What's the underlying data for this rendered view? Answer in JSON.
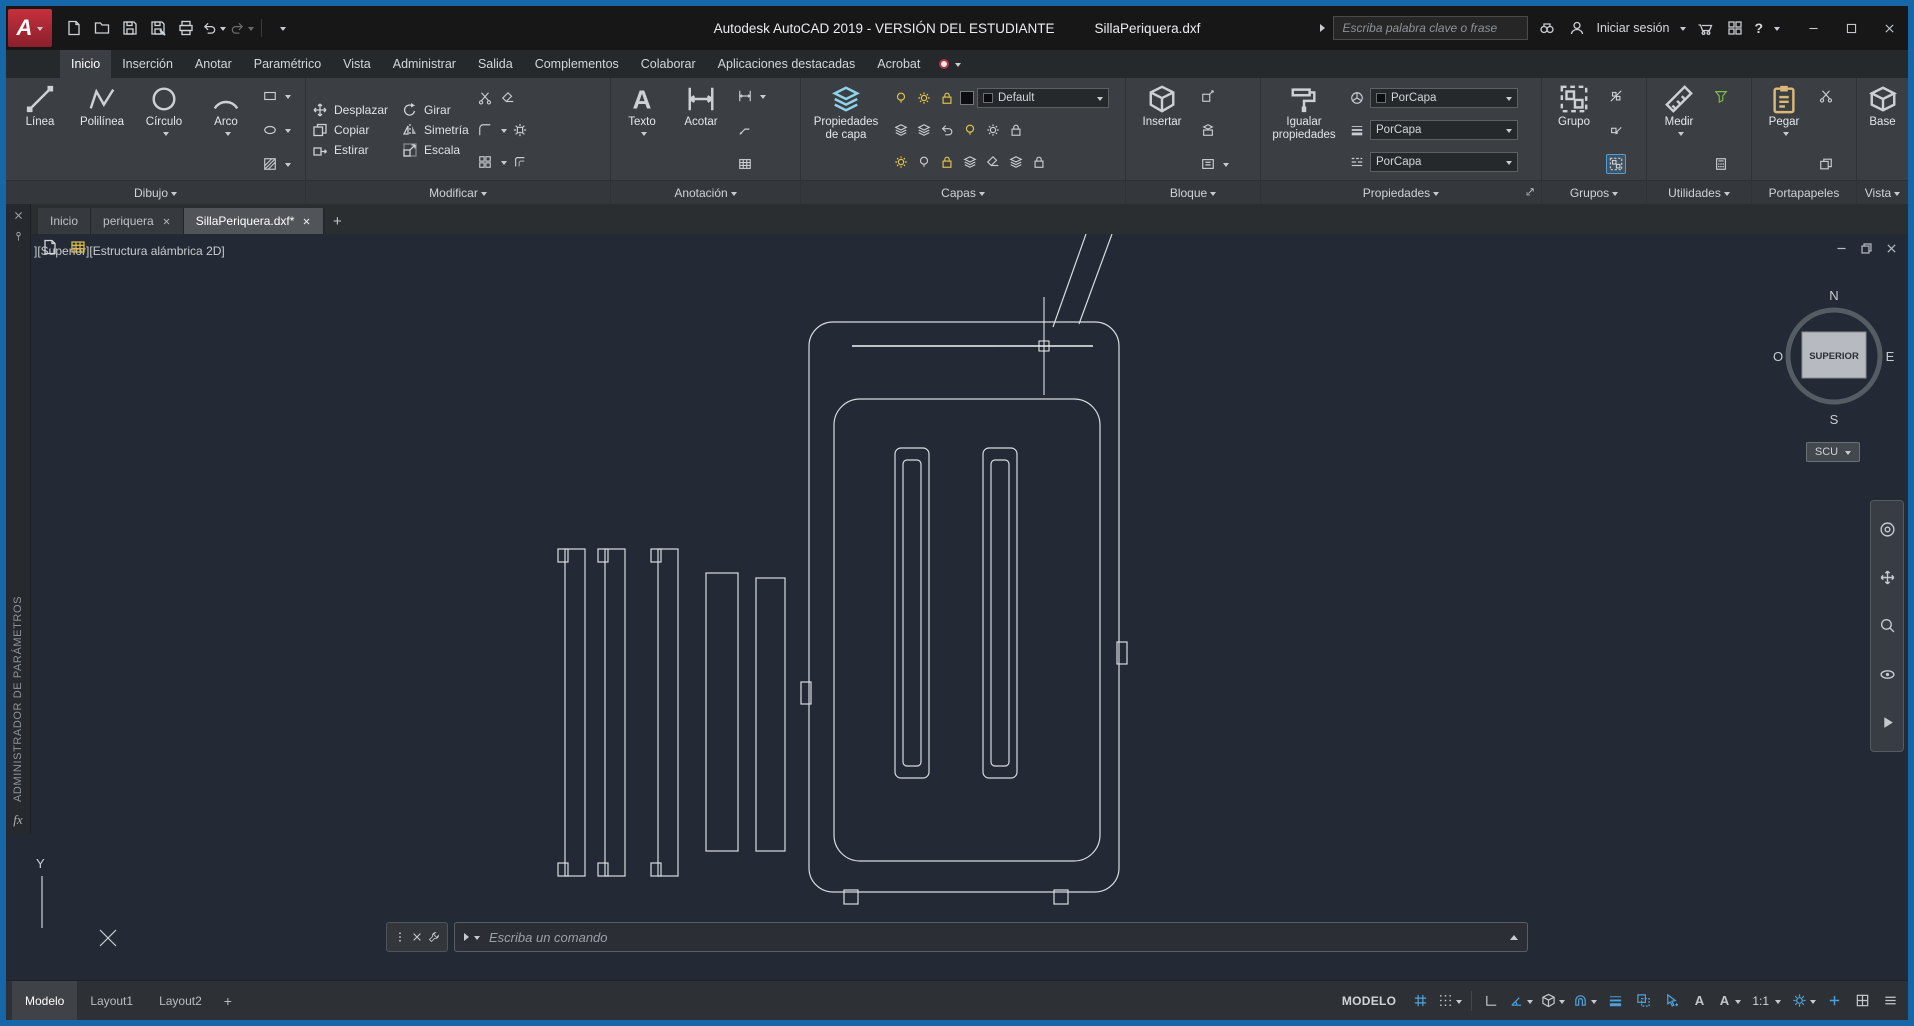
{
  "titlebar": {
    "logo_letter": "A",
    "app_title": "Autodesk AutoCAD 2019 - VERSIÓN DEL ESTUDIANTE",
    "doc_title": "SillaPeriquera.dxf",
    "search_placeholder": "Escriba palabra clave o frase",
    "sign_in_label": "Iniciar sesión",
    "help_label": "?"
  },
  "ribbon_tabs": {
    "items": [
      {
        "label": "Inicio"
      },
      {
        "label": "Inserción"
      },
      {
        "label": "Anotar"
      },
      {
        "label": "Paramétrico"
      },
      {
        "label": "Vista"
      },
      {
        "label": "Administrar"
      },
      {
        "label": "Salida"
      },
      {
        "label": "Complementos"
      },
      {
        "label": "Colaborar"
      },
      {
        "label": "Aplicaciones destacadas"
      },
      {
        "label": "Acrobat"
      }
    ]
  },
  "ribbon": {
    "dibujo": {
      "label": "Dibujo",
      "linea": "Línea",
      "polilinea": "Polilínea",
      "circulo": "Círculo",
      "arco": "Arco"
    },
    "modificar": {
      "label": "Modificar",
      "items": [
        "Desplazar",
        "Girar",
        "Copiar",
        "Simetría",
        "Estirar",
        "Escala"
      ]
    },
    "anotacion": {
      "label": "Anotación",
      "texto": "Texto",
      "acotar": "Acotar"
    },
    "capas": {
      "label": "Capas",
      "propiedades_capa": "Propiedades de capa",
      "estado": "Default"
    },
    "bloque": {
      "label": "Bloque",
      "insertar": "Insertar"
    },
    "propiedades": {
      "label": "Propiedades",
      "igualar": "Igualar propiedades",
      "color": "PorCapa",
      "grosor": "PorCapa",
      "tipo_linea": "PorCapa"
    },
    "grupos": {
      "label": "Grupos",
      "grupo": "Grupo"
    },
    "utilidades": {
      "label": "Utilidades",
      "medir": "Medir"
    },
    "portapapeles": {
      "label": "Portapapeles",
      "pegar": "Pegar"
    },
    "vista_panel": {
      "label": "Vista",
      "base": "Base"
    }
  },
  "file_tabs": {
    "items": [
      {
        "label": "Inicio"
      },
      {
        "label": "periquera"
      },
      {
        "label": "SillaPeriquera.dxf*"
      }
    ],
    "new_tab": "+"
  },
  "viewport": {
    "label": "][Superior][Estructura alámbrica 2D]",
    "ucs_y": "Y",
    "compass": {
      "n": "N",
      "e": "E",
      "s": "S",
      "o": "O",
      "cube": "SUPERIOR",
      "scu": "SCU"
    },
    "palette_title": "ADMINISTRADOR DE PARÁMETROS",
    "palette_fx": "fx"
  },
  "command_line": {
    "prompt": "Escriba un comando"
  },
  "statusbar": {
    "layout_tabs": [
      "Modelo",
      "Layout1",
      "Layout2"
    ],
    "new_layout": "+",
    "space_label": "MODELO",
    "annotation_scale": "1:1"
  }
}
